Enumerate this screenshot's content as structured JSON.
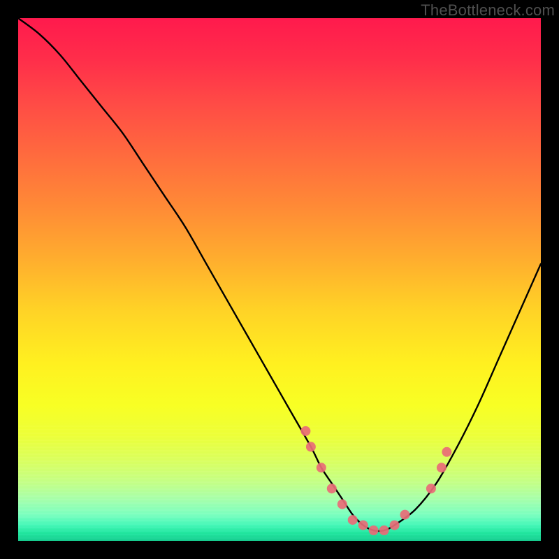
{
  "watermark": "TheBottleneck.com",
  "colors": {
    "frame": "#000000",
    "curve": "#000000",
    "markers": "#e96b77",
    "watermark": "#4f4f4f"
  },
  "chart_data": {
    "type": "line",
    "title": "",
    "xlabel": "",
    "ylabel": "",
    "xlim": [
      0,
      100
    ],
    "ylim": [
      0,
      100
    ],
    "grid": false,
    "legend": false,
    "series": [
      {
        "name": "bottleneck-curve",
        "x": [
          0,
          4,
          8,
          12,
          16,
          20,
          24,
          28,
          32,
          36,
          40,
          44,
          48,
          52,
          56,
          58,
          60,
          62,
          64,
          66,
          68,
          70,
          72,
          76,
          80,
          84,
          88,
          92,
          96,
          100
        ],
        "values": [
          100,
          97,
          93,
          88,
          83,
          78,
          72,
          66,
          60,
          53,
          46,
          39,
          32,
          25,
          18,
          14,
          11,
          8,
          5,
          3,
          2,
          2,
          3,
          6,
          11,
          18,
          26,
          35,
          44,
          53
        ]
      }
    ],
    "markers": {
      "name": "highlight-points",
      "x": [
        55,
        56,
        58,
        60,
        62,
        64,
        66,
        68,
        70,
        72,
        74,
        79,
        81,
        82
      ],
      "values": [
        21,
        18,
        14,
        10,
        7,
        4,
        3,
        2,
        2,
        3,
        5,
        10,
        14,
        17
      ]
    }
  }
}
